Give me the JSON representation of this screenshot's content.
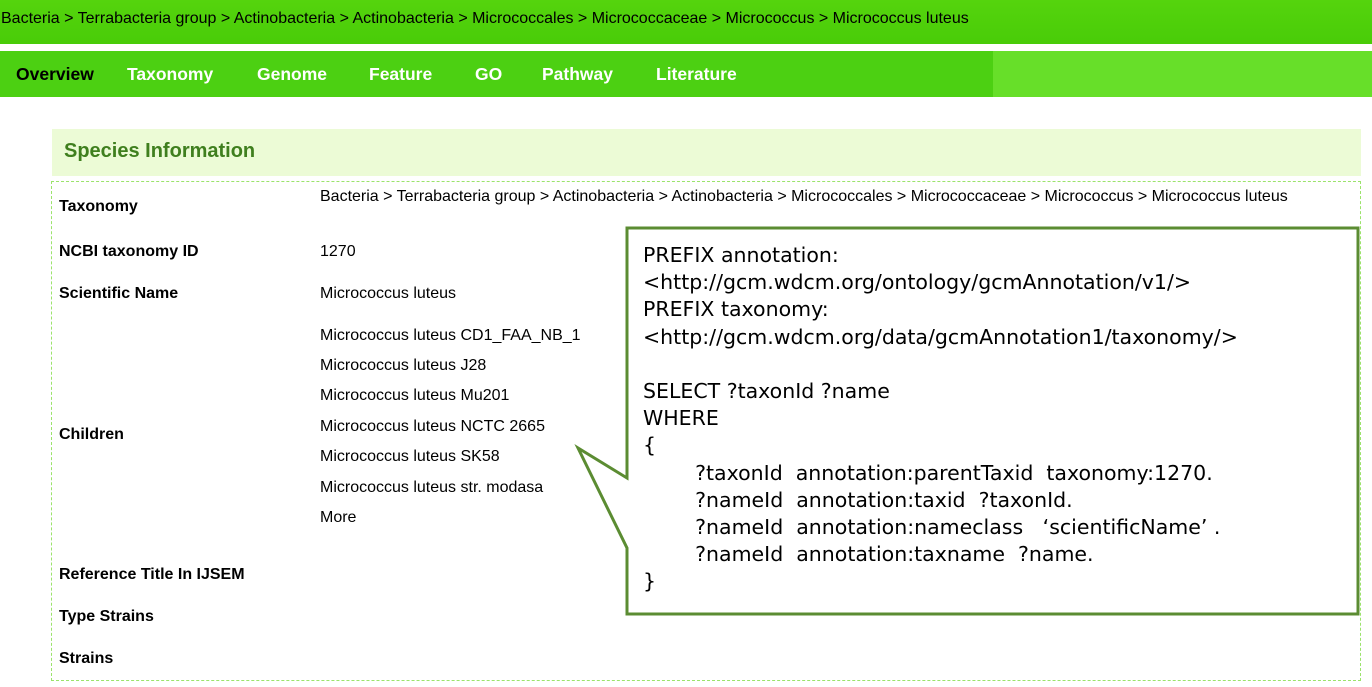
{
  "breadcrumb": "Bacteria > Terrabacteria group > Actinobacteria > Actinobacteria > Micrococcales > Micrococcaceae > Micrococcus > Micrococcus luteus",
  "nav": {
    "items": [
      {
        "label": "Overview",
        "active": true
      },
      {
        "label": "Taxonomy",
        "active": false
      },
      {
        "label": "Genome",
        "active": false
      },
      {
        "label": "Feature",
        "active": false
      },
      {
        "label": "GO",
        "active": false
      },
      {
        "label": "Pathway",
        "active": false
      },
      {
        "label": "Literature",
        "active": false
      }
    ]
  },
  "species": {
    "title": "Species Information",
    "taxonomy_label": "Taxonomy",
    "taxonomy_value": "Bacteria > Terrabacteria group > Actinobacteria > Actinobacteria > Micrococcales > Micrococcaceae > Micrococcus > Micrococcus luteus",
    "ncbi_label": "NCBI taxonomy ID",
    "ncbi_value": "1270",
    "sci_label": "Scientific Name",
    "sci_value": "Micrococcus luteus",
    "children_label": "Children",
    "children": [
      "Micrococcus luteus CD1_FAA_NB_1",
      "Micrococcus luteus J28",
      "Micrococcus luteus Mu201",
      "Micrococcus luteus NCTC 2665",
      "Micrococcus luteus SK58",
      "Micrococcus luteus str. modasa",
      "More"
    ],
    "ref_label": "Reference Title In IJSEM",
    "type_strains_label": "Type Strains",
    "strains_label": "Strains"
  },
  "callout": {
    "lines": [
      "PREFIX annotation:",
      "<http://gcm.wdcm.org/ontology/gcmAnnotation/v1/>",
      "PREFIX taxonomy:",
      "<http://gcm.wdcm.org/data/gcmAnnotation1/taxonomy/>",
      "",
      "SELECT ?taxonId ?name",
      "WHERE",
      "{",
      "        ?taxonId  annotation:parentTaxid  taxonomy:1270.",
      "        ?nameId  annotation:taxid  ?taxonId.",
      "        ?nameId  annotation:nameclass   ‘scientificName’ .",
      "        ?nameId  annotation:taxname  ?name.",
      "}"
    ]
  },
  "colors": {
    "header_green": "#49cc08",
    "nav_green": "#4cd012",
    "title_green": "#3f7f1e",
    "panel_bg": "#ecfbd6",
    "callout_border": "#5b8c32"
  }
}
